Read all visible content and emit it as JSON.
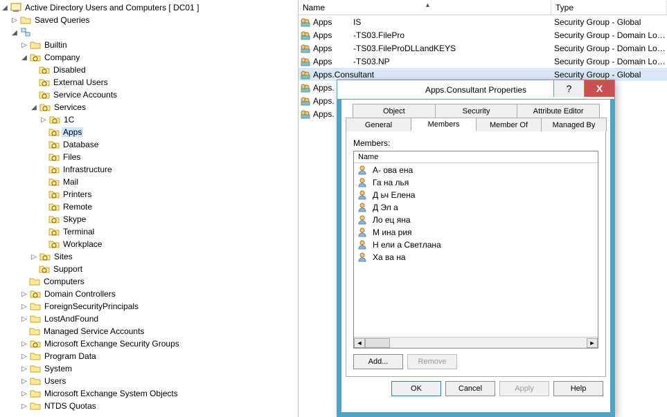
{
  "tree": {
    "root_label": "Active Directory Users and Computers [      DC01                          ]",
    "saved_queries": "Saved Queries",
    "domain_root": "",
    "builtin": "Builtin",
    "company": "Company",
    "disabled": "Disabled",
    "external_users": "External Users",
    "service_accounts": "Service Accounts",
    "services": "Services",
    "svc_1c": "1C",
    "svc_apps": "Apps",
    "svc_database": "Database",
    "svc_files": "Files",
    "svc_infra": "Infrastructure",
    "svc_mail": "Mail",
    "svc_printers": "Printers",
    "svc_remote": "Remote",
    "svc_skype": "Skype",
    "svc_terminal": "Terminal",
    "svc_workplace": "Workplace",
    "sites": "Sites",
    "support": "Support",
    "computers": "Computers",
    "domain_ctrl": "Domain Controllers",
    "fsp": "ForeignSecurityPrincipals",
    "lostfound": "LostAndFound",
    "msa": "Managed Service Accounts",
    "mesg": "Microsoft Exchange Security Groups",
    "progdata": "Program Data",
    "system": "System",
    "users": "Users",
    "meso": "Microsoft Exchange System Objects",
    "ntds": "NTDS Quotas"
  },
  "list": {
    "col_name": "Name",
    "col_type": "Type",
    "rows": [
      {
        "n1": "Apps",
        "n2": "IS",
        "type": "Security Group - Global"
      },
      {
        "n1": "Apps",
        "n2": "-TS03.FilePro",
        "type": "Security Group - Domain Local"
      },
      {
        "n1": "Apps",
        "n2": "-TS03.FileProDLLandKEYS",
        "type": "Security Group - Domain Local"
      },
      {
        "n1": "Apps",
        "n2": "-TS03.NP",
        "type": "Security Group - Domain Local"
      },
      {
        "n1": "Apps.Consultant",
        "n2": "",
        "type": "Security Group - Global",
        "selected": true
      },
      {
        "n1": "Apps.",
        "n2": "",
        "type": "bal"
      },
      {
        "n1": "Apps.",
        "n2": "",
        "type": "bal"
      },
      {
        "n1": "Apps.",
        "n2": "",
        "type": ""
      }
    ]
  },
  "dialog": {
    "title": "Apps.Consultant Properties",
    "help_glyph": "?",
    "close_glyph": "X",
    "tabs_top": [
      "Object",
      "Security",
      "Attribute Editor"
    ],
    "tabs_bottom": [
      "General",
      "Members",
      "Member Of",
      "Managed By"
    ],
    "active_tab": "Members",
    "members_label": "Members:",
    "members_col": "Name",
    "members": [
      "А-       ова       ена",
      "Га       на        лья",
      "Д        ьч        Елена",
      "Д        Эл        а",
      "Ло       ец        яна",
      "М        ина       рия",
      "Н        ели       а Светлана",
      "Ха       ва        на"
    ],
    "btn_add": "Add...",
    "btn_remove": "Remove",
    "btn_ok": "OK",
    "btn_cancel": "Cancel",
    "btn_apply": "Apply",
    "btn_help": "Help"
  }
}
